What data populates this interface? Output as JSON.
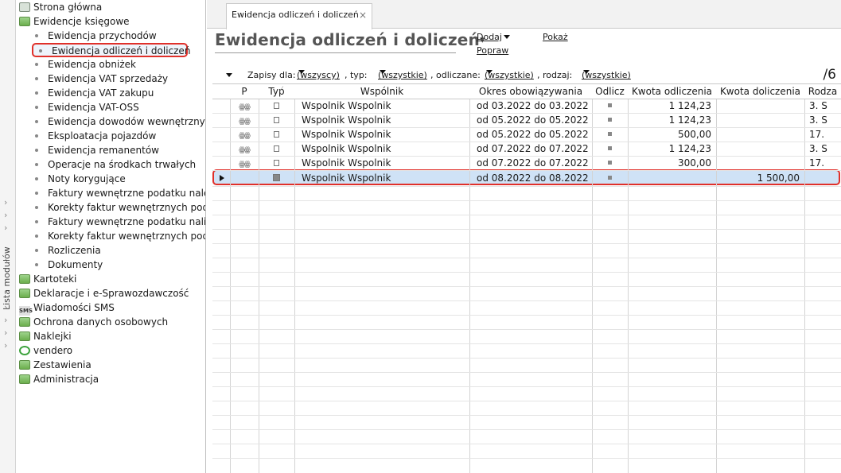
{
  "sidebar": {
    "module_strip_label": "Lista modułów",
    "items": [
      {
        "label": "Strona główna",
        "icon": "home-icon"
      },
      {
        "label": "Ewidencje księgowe",
        "icon": "folder-open-icon",
        "children": [
          {
            "label": "Ewidencja przychodów"
          },
          {
            "label": "Ewidencja odliczeń i doliczeń",
            "selected": true
          },
          {
            "label": "Ewidencja obniżek"
          },
          {
            "label": "Ewidencja VAT sprzedaży"
          },
          {
            "label": "Ewidencja VAT zakupu"
          },
          {
            "label": "Ewidencja VAT-OSS"
          },
          {
            "label": "Ewidencja dowodów wewnętrznych"
          },
          {
            "label": "Eksploatacja pojazdów"
          },
          {
            "label": "Ewidencja remanentów"
          },
          {
            "label": "Operacje na środkach trwałych"
          },
          {
            "label": "Noty korygujące"
          },
          {
            "label": "Faktury wewnętrzne podatku należn"
          },
          {
            "label": "Korekty faktur wewnętrznych podatl"
          },
          {
            "label": "Faktury wewnętrzne podatku naliczo"
          },
          {
            "label": "Korekty faktur wewnętrznych podatl"
          },
          {
            "label": "Rozliczenia"
          },
          {
            "label": "Dokumenty"
          }
        ]
      },
      {
        "label": "Kartoteki",
        "icon": "folder-icon"
      },
      {
        "label": "Deklaracje i e-Sprawozdawczość",
        "icon": "folder-icon"
      },
      {
        "label": "Wiadomości SMS",
        "icon": "sms-icon"
      },
      {
        "label": "Ochrona danych osobowych",
        "icon": "folder-icon"
      },
      {
        "label": "Naklejki",
        "icon": "folder-icon"
      },
      {
        "label": "vendero",
        "icon": "recycle-icon"
      },
      {
        "label": "Zestawienia",
        "icon": "folder-icon"
      },
      {
        "label": "Administracja",
        "icon": "folder-icon"
      }
    ]
  },
  "tab": {
    "label": "Ewidencja odliczeń i doliczeń",
    "close": "×"
  },
  "page": {
    "title": "Ewidencja odliczeń i doliczeń",
    "title_dropdown": "▾",
    "actions": {
      "dodaj": "Dodaj",
      "popraw": "Popraw",
      "pokaz": "Pokaż"
    }
  },
  "filters": {
    "zapisy_label": "Zapisy dla:",
    "zapisy_value": "(wszyscy)",
    "typ_label": ", typ:",
    "typ_value": "(wszystkie)",
    "odliczane_label": ", odliczane:",
    "odliczane_value": "(wszystkie)",
    "rodzaj_label": ", rodzaj:",
    "rodzaj_value": "(wszystkie)",
    "count": "/6"
  },
  "grid": {
    "columns": [
      "P",
      "Typ",
      "Wspólnik",
      "Okres obowiązywania",
      "Odlicz",
      "Kwota odliczenia",
      "Kwota doliczenia",
      "Rodza"
    ],
    "rows": [
      {
        "wspolnik": "Wspolnik Wspolnik",
        "okres": "od 03.2022 do 03.2022",
        "kwota_odl": "1 124,23",
        "kwota_dol": "",
        "rodzaj": "3. S"
      },
      {
        "wspolnik": "Wspolnik Wspolnik",
        "okres": "od 05.2022 do 05.2022",
        "kwota_odl": "1 124,23",
        "kwota_dol": "",
        "rodzaj": "3. S"
      },
      {
        "wspolnik": "Wspolnik Wspolnik",
        "okres": "od 05.2022 do 05.2022",
        "kwota_odl": "500,00",
        "kwota_dol": "",
        "rodzaj": "17."
      },
      {
        "wspolnik": "Wspolnik Wspolnik",
        "okres": "od 07.2022 do 07.2022",
        "kwota_odl": "1 124,23",
        "kwota_dol": "",
        "rodzaj": "3. S"
      },
      {
        "wspolnik": "Wspolnik Wspolnik",
        "okres": "od 07.2022 do 07.2022",
        "kwota_odl": "300,00",
        "kwota_dol": "",
        "rodzaj": "17."
      },
      {
        "wspolnik": "Wspolnik Wspolnik",
        "okres": "od 08.2022 do 08.2022",
        "kwota_odl": "",
        "kwota_dol": "1 500,00",
        "rodzaj": "",
        "selected": true
      }
    ]
  },
  "colors": {
    "selection_outline": "#e0302a",
    "row_selected_bg": "#cfe2f6"
  }
}
